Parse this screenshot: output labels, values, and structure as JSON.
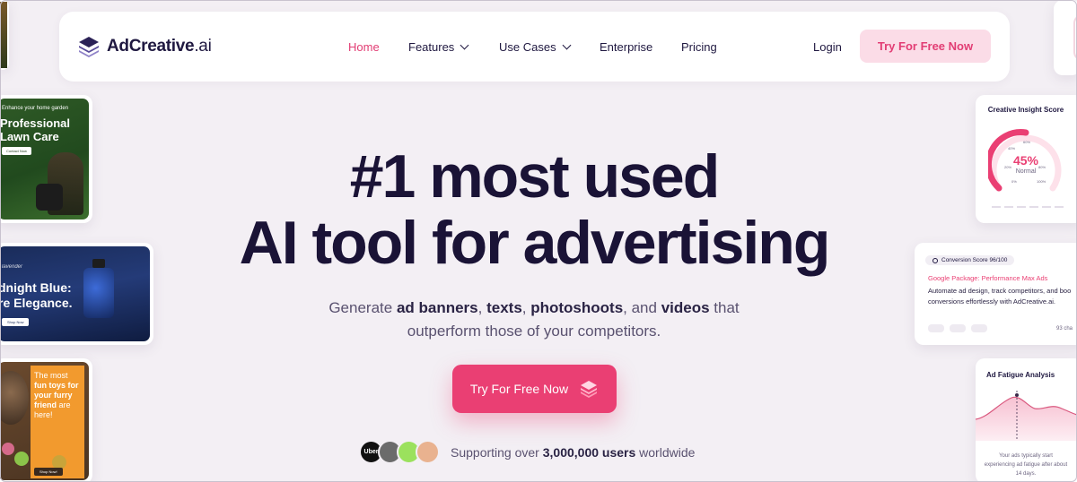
{
  "nav": {
    "logo_main": "AdCreative",
    "logo_suffix": ".ai",
    "links": [
      "Home",
      "Features",
      "Use Cases",
      "Enterprise",
      "Pricing"
    ],
    "login": "Login",
    "cta": "Try For Free Now"
  },
  "hero": {
    "title_line1": "#1 most used",
    "title_line2": "AI tool for advertising",
    "subtitle": {
      "s1": "Generate ",
      "b1": "ad banners",
      "s2": ", ",
      "b2": "texts",
      "s3": ", ",
      "b3": "photoshoots",
      "s4": ", and ",
      "b4": "videos",
      "s5": " that",
      "line2": "outperform those of your competitors."
    },
    "cta": "Try For Free Now",
    "support": {
      "prefix": "Supporting over ",
      "count": "3,000,000 users",
      "suffix": " worldwide"
    },
    "avatars": [
      "Uber",
      "",
      "",
      ""
    ]
  },
  "left_ads": {
    "lawn": {
      "top": "Enhance your home garden",
      "title_line1": "Professional",
      "title_line2": "Lawn Care",
      "button": "Contact Now"
    },
    "perfume": {
      "brand": "lavender",
      "title_line1": "dnight Blue:",
      "title_line2": "re Elegance.",
      "button": "Shop Now"
    },
    "pets": {
      "line1": "The most",
      "line2": "fun toys for",
      "line3": "your furry",
      "line4": "friend",
      "line4b": " are",
      "line5": "here!",
      "button": "Shop Now!"
    }
  },
  "right_panels": {
    "insight": {
      "title": "Creative Insight Score",
      "value": "45%",
      "label": "Normal",
      "ticks": [
        "60%",
        "40%",
        "20%",
        "80%",
        "0%",
        "100%"
      ]
    },
    "conversion": {
      "badge": "Conversion Score 96/100",
      "headline": "Google Package: Performance Max Ads",
      "body_line1": "Automate ad design, track competitors, and boo",
      "body_line2": "conversions effortlessly with AdCreative.ai.",
      "count": "93 cha"
    },
    "fatigue": {
      "title": "Ad Fatigue Analysis",
      "note_line1": "Your ads typically start",
      "note_line2": "experiencing ad fatigue after about",
      "note_line3": "14 days."
    }
  },
  "colors": {
    "accent": "#ea3f73",
    "navy": "#1a1336",
    "background": "#f3eff4"
  }
}
